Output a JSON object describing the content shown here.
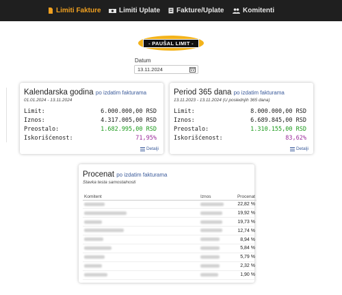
{
  "nav": {
    "items": [
      {
        "label": "Limiti Fakture",
        "icon": "document-icon",
        "active": true
      },
      {
        "label": "Limiti Uplate",
        "icon": "money-icon",
        "active": false
      },
      {
        "label": "Fakture/Uplate",
        "icon": "ledger-icon",
        "active": false
      },
      {
        "label": "Komitenti",
        "icon": "users-icon",
        "active": false
      }
    ]
  },
  "logo": {
    "text": "- PAUŠAL LIMIT -"
  },
  "datum": {
    "label": "Datum",
    "value": "13.11.2024"
  },
  "cards": {
    "calendar": {
      "title": "Kalendarska godina",
      "subtitle": "po izdatim fakturama",
      "date_range": "01.01.2024 - 13.11.2024",
      "rows": [
        {
          "label": "Limit:",
          "value": "6.000.000,00 RSD"
        },
        {
          "label": "Iznos:",
          "value": "4.317.005,00 RSD"
        },
        {
          "label": "Preostalo:",
          "value": "1.682.995,00 RSD"
        },
        {
          "label": "Iskorišćenost:",
          "value": "71,95%"
        }
      ],
      "details": "Detalji"
    },
    "period": {
      "title": "Period 365 dana",
      "subtitle": "po izdatim fakturama",
      "date_range": "13.11.2023 - 13.11.2024 (U poslednjih 365 dana)",
      "rows": [
        {
          "label": "Limit:",
          "value": "8.000.000,00 RSD"
        },
        {
          "label": "Iznos:",
          "value": "6.689.845,00 RSD"
        },
        {
          "label": "Preostalo:",
          "value": "1.310.155,00 RSD"
        },
        {
          "label": "Iskorišćenost:",
          "value": "83,62%"
        }
      ],
      "details": "Detalji"
    },
    "procenat": {
      "title": "Procenat",
      "subtitle": "po izdatim fakturama",
      "caption": "Stavka testa samostalnosti",
      "headers": {
        "komitent": "Komitent",
        "iznos": "Iznos",
        "procenat": "Procenat"
      },
      "rows": [
        {
          "procenat": "22,82 %"
        },
        {
          "procenat": "19,92 %"
        },
        {
          "procenat": "19,73 %"
        },
        {
          "procenat": "12,74 %"
        },
        {
          "procenat": "8,94 %"
        },
        {
          "procenat": "5,84 %"
        },
        {
          "procenat": "5,79 %"
        },
        {
          "procenat": "2,32 %"
        },
        {
          "procenat": "1,90 %"
        }
      ]
    }
  },
  "colors": {
    "navbar": "#1f1f1f",
    "active": "#f0a020",
    "positive": "#1a9a1a",
    "usage": "#9a2a9a",
    "link": "#3a5a9a",
    "logo": "#f3b31b"
  }
}
